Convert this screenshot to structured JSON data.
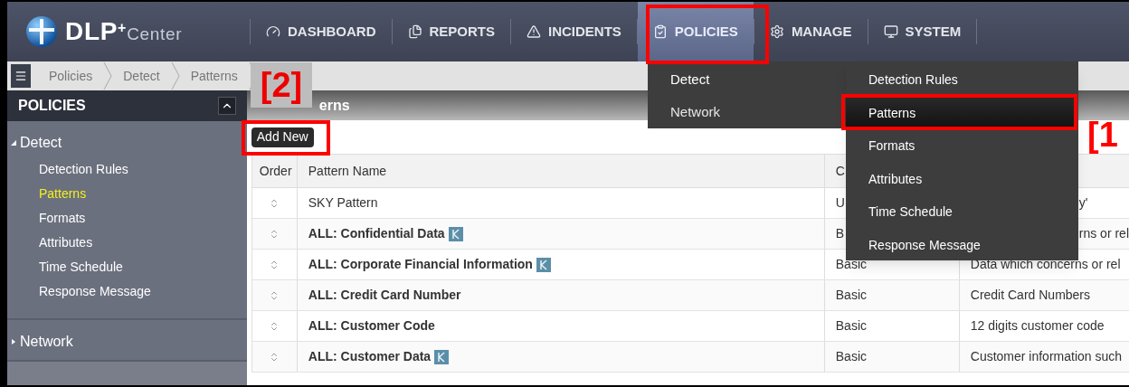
{
  "brand": {
    "name": "DLP",
    "sup": "+",
    "suffix": "Center"
  },
  "nav": [
    {
      "label": "DASHBOARD",
      "selected": false
    },
    {
      "label": "REPORTS",
      "selected": false
    },
    {
      "label": "INCIDENTS",
      "selected": false
    },
    {
      "label": "POLICIES",
      "selected": true
    },
    {
      "label": "MANAGE",
      "selected": false
    },
    {
      "label": "SYSTEM",
      "selected": false
    }
  ],
  "breadcrumb": [
    "Policies",
    "Detect",
    "Patterns"
  ],
  "sidebar": {
    "title": "POLICIES",
    "groups": [
      {
        "label": "Detect",
        "expanded": true,
        "children": [
          {
            "label": "Detection Rules",
            "selected": false
          },
          {
            "label": "Patterns",
            "selected": true
          },
          {
            "label": "Formats",
            "selected": false
          },
          {
            "label": "Attributes",
            "selected": false
          },
          {
            "label": "Time Schedule",
            "selected": false
          },
          {
            "label": "Response Message",
            "selected": false
          }
        ]
      },
      {
        "label": "Network",
        "expanded": false
      }
    ]
  },
  "content": {
    "title": "erns",
    "add_button": "Add New",
    "table": {
      "columns": [
        "Order",
        "Pattern Name",
        "C"
      ],
      "rows": [
        {
          "name": "SKY Pattern",
          "bold": false,
          "keyword": false,
          "type": "U",
          "description": "y'",
          "covered": true
        },
        {
          "name": "ALL: Confidential Data",
          "bold": true,
          "keyword": true,
          "type": "B",
          "description": "rns or rel",
          "covered": true
        },
        {
          "name": "ALL: Corporate Financial Information",
          "bold": true,
          "keyword": true,
          "type": "Basic",
          "description": "Data which concerns or rel",
          "covered": false
        },
        {
          "name": "ALL: Credit Card Number",
          "bold": true,
          "keyword": false,
          "type": "Basic",
          "description": "Credit Card Numbers",
          "covered": false
        },
        {
          "name": "ALL: Customer Code",
          "bold": true,
          "keyword": false,
          "type": "Basic",
          "description": "12 digits customer code",
          "covered": false
        },
        {
          "name": "ALL: Customer Data",
          "bold": true,
          "keyword": true,
          "type": "Basic",
          "description": "Customer information such",
          "covered": false
        }
      ]
    }
  },
  "menu": {
    "sections": [
      {
        "label": "Detect",
        "selected": true
      },
      {
        "label": "Network",
        "selected": false
      }
    ],
    "items": [
      {
        "label": "Detection Rules",
        "selected": false
      },
      {
        "label": "Patterns",
        "selected": true
      },
      {
        "label": "Formats",
        "selected": false
      },
      {
        "label": "Attributes",
        "selected": false
      },
      {
        "label": "Time Schedule",
        "selected": false
      },
      {
        "label": "Response Message",
        "selected": false
      }
    ]
  },
  "callouts": [
    {
      "label": "[1"
    },
    {
      "label": "[2]"
    }
  ]
}
